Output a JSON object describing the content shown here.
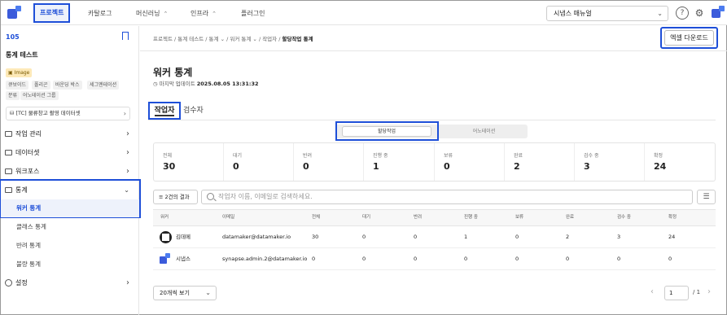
{
  "nav": {
    "items": [
      {
        "label": "프로젝트"
      },
      {
        "label": "카탈로그"
      },
      {
        "label": "머신러닝"
      },
      {
        "label": "인프라"
      },
      {
        "label": "플러그인"
      }
    ],
    "manual_label": "시냅스 매뉴얼",
    "help_icon": "?",
    "settings_icon": "gear-icon"
  },
  "sidebar": {
    "project_id": "105",
    "project_title": "통계 테스트",
    "type_tag": "Image",
    "tags": [
      "큐보이드",
      "폴리곤",
      "바운딩 박스",
      "세그멘테이션",
      "분류",
      "어노테이션 그룹"
    ],
    "dataset": "[TC] 물류창고 촬영 데이터셋",
    "menu": [
      {
        "label": "작업 관리"
      },
      {
        "label": "데이터셋"
      },
      {
        "label": "워크포스"
      },
      {
        "label": "통계"
      }
    ],
    "stats_sub": [
      {
        "label": "워커 통계"
      },
      {
        "label": "클래스 통계"
      },
      {
        "label": "반려 통계"
      },
      {
        "label": "불량 통계"
      }
    ],
    "settings_label": "설정"
  },
  "main": {
    "breadcrumb": {
      "items": [
        "프로젝트",
        "통계 테스트",
        "통계",
        "워커 통계",
        "작업자"
      ],
      "current": "할당작업 통계"
    },
    "excel_button": "엑셀 다운로드",
    "title": "워커 통계",
    "updated_label": "마지막 업데이트",
    "updated_value": "2025.08.05 13:31:32",
    "tabs": [
      {
        "label": "작업자"
      },
      {
        "label": "검수자"
      }
    ],
    "segment": {
      "active": "할당작업",
      "inactive": "어노테이션"
    },
    "stats": [
      {
        "label": "전체",
        "value": "30"
      },
      {
        "label": "대기",
        "value": "0"
      },
      {
        "label": "반려",
        "value": "0"
      },
      {
        "label": "진행 중",
        "value": "1"
      },
      {
        "label": "보류",
        "value": "0"
      },
      {
        "label": "완료",
        "value": "2"
      },
      {
        "label": "검수 중",
        "value": "3"
      },
      {
        "label": "확정",
        "value": "24"
      }
    ],
    "filter_label": "2건의 결과",
    "search_placeholder": "작업자 이름, 이메일로 검색하세요.",
    "table": {
      "headers": [
        "워커",
        "이메일",
        "전체",
        "대기",
        "반려",
        "진행 중",
        "보류",
        "완료",
        "검수 중",
        "확정"
      ],
      "rows": [
        [
          "김데메",
          "datamaker@datamaker.io",
          "30",
          "0",
          "0",
          "1",
          "0",
          "2",
          "3",
          "24"
        ],
        [
          "시냅스",
          "synapse.admin.2@datamaker.io",
          "0",
          "0",
          "0",
          "0",
          "0",
          "0",
          "0",
          "0"
        ]
      ]
    },
    "page_size": "20개씩 보기",
    "page_current": "1",
    "page_total": "/ 1"
  },
  "colors": {
    "accent": "#1e4fd8",
    "highlight_bg": "#eef2fb"
  }
}
